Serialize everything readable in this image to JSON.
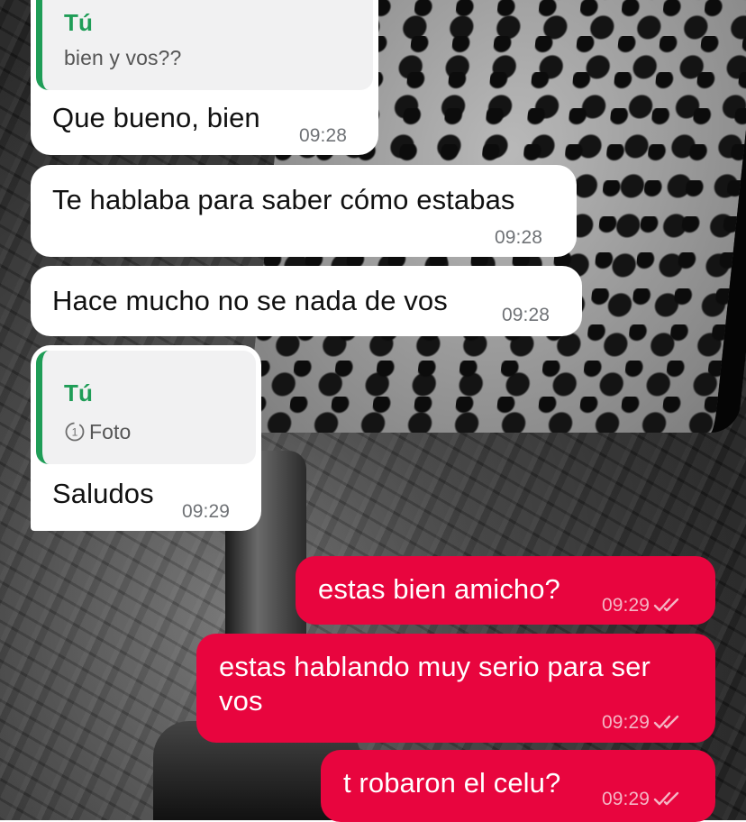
{
  "chat": {
    "messages": [
      {
        "direction": "in",
        "quote_author": "Tú",
        "quote_text": "bien y vos??",
        "text": "Que bueno, bien",
        "time": "09:28"
      },
      {
        "direction": "in",
        "text": "Te hablaba para saber cómo estabas",
        "time": "09:28"
      },
      {
        "direction": "in",
        "text": "Hace mucho no se nada de vos",
        "time": "09:28"
      },
      {
        "direction": "in",
        "quote_author": "Tú",
        "quote_text": "Foto",
        "quote_icon": "view-once-icon",
        "text": "Saludos",
        "time": "09:29"
      },
      {
        "direction": "out",
        "text": "estas bien amicho?",
        "time": "09:29",
        "status": "read-double-check"
      },
      {
        "direction": "out",
        "text": "estas hablando muy serio para ser vos",
        "time": "09:29",
        "status": "read-double-check"
      },
      {
        "direction": "out",
        "text": "t robaron el celu?",
        "time": "09:29",
        "status": "read-double-check"
      }
    ]
  },
  "colors": {
    "incoming_bubble": "#ffffff",
    "outgoing_bubble": "#e8053e",
    "quote_accent": "#1f9d57",
    "timestamp": "#6f7276"
  }
}
